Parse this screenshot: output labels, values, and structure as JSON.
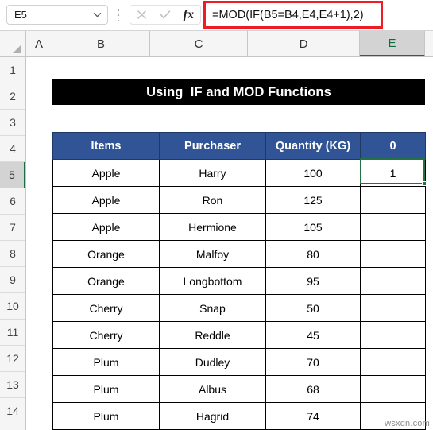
{
  "formula_bar": {
    "name_box_value": "E5",
    "name_box_icon": "chevron-down-icon",
    "kebab_icon": "more-options-icon",
    "cancel_icon": "cancel-x-icon",
    "confirm_icon": "confirm-check-icon",
    "fx_label": "fx",
    "formula": "=MOD(IF(B5=B4,E4,E4+1),2)",
    "highlight_color": "#EE1C25"
  },
  "grid": {
    "columns": [
      "A",
      "B",
      "C",
      "D",
      "E"
    ],
    "selected_column": "E",
    "rows": [
      "1",
      "2",
      "3",
      "4",
      "5",
      "6",
      "7",
      "8",
      "9",
      "10",
      "11",
      "12",
      "13",
      "14"
    ],
    "selected_row": "5",
    "select_all_icon": "select-all-corner-icon"
  },
  "sheet": {
    "title": "Using  IF and MOD Functions",
    "title_bg": "#000000",
    "title_color": "#FFFFFF",
    "header_bg": "#305496",
    "header_color": "#FFFFFF",
    "selection_color": "#217346",
    "table": {
      "headers": [
        "Items",
        "Purchaser",
        "Quantity (KG)",
        "0"
      ],
      "rows": [
        {
          "items": "Apple",
          "purchaser": "Harry",
          "quantity": "100",
          "result": "1"
        },
        {
          "items": "Apple",
          "purchaser": "Ron",
          "quantity": "125",
          "result": ""
        },
        {
          "items": "Apple",
          "purchaser": "Hermione",
          "quantity": "105",
          "result": ""
        },
        {
          "items": "Orange",
          "purchaser": "Malfoy",
          "quantity": "80",
          "result": ""
        },
        {
          "items": "Orange",
          "purchaser": "Longbottom",
          "quantity": "95",
          "result": ""
        },
        {
          "items": "Cherry",
          "purchaser": "Snap",
          "quantity": "50",
          "result": ""
        },
        {
          "items": "Cherry",
          "purchaser": "Reddle",
          "quantity": "45",
          "result": ""
        },
        {
          "items": "Plum",
          "purchaser": "Dudley",
          "quantity": "70",
          "result": ""
        },
        {
          "items": "Plum",
          "purchaser": "Albus",
          "quantity": "68",
          "result": ""
        },
        {
          "items": "Plum",
          "purchaser": "Hagrid",
          "quantity": "74",
          "result": ""
        }
      ]
    }
  },
  "watermark": "wsxdn.com"
}
